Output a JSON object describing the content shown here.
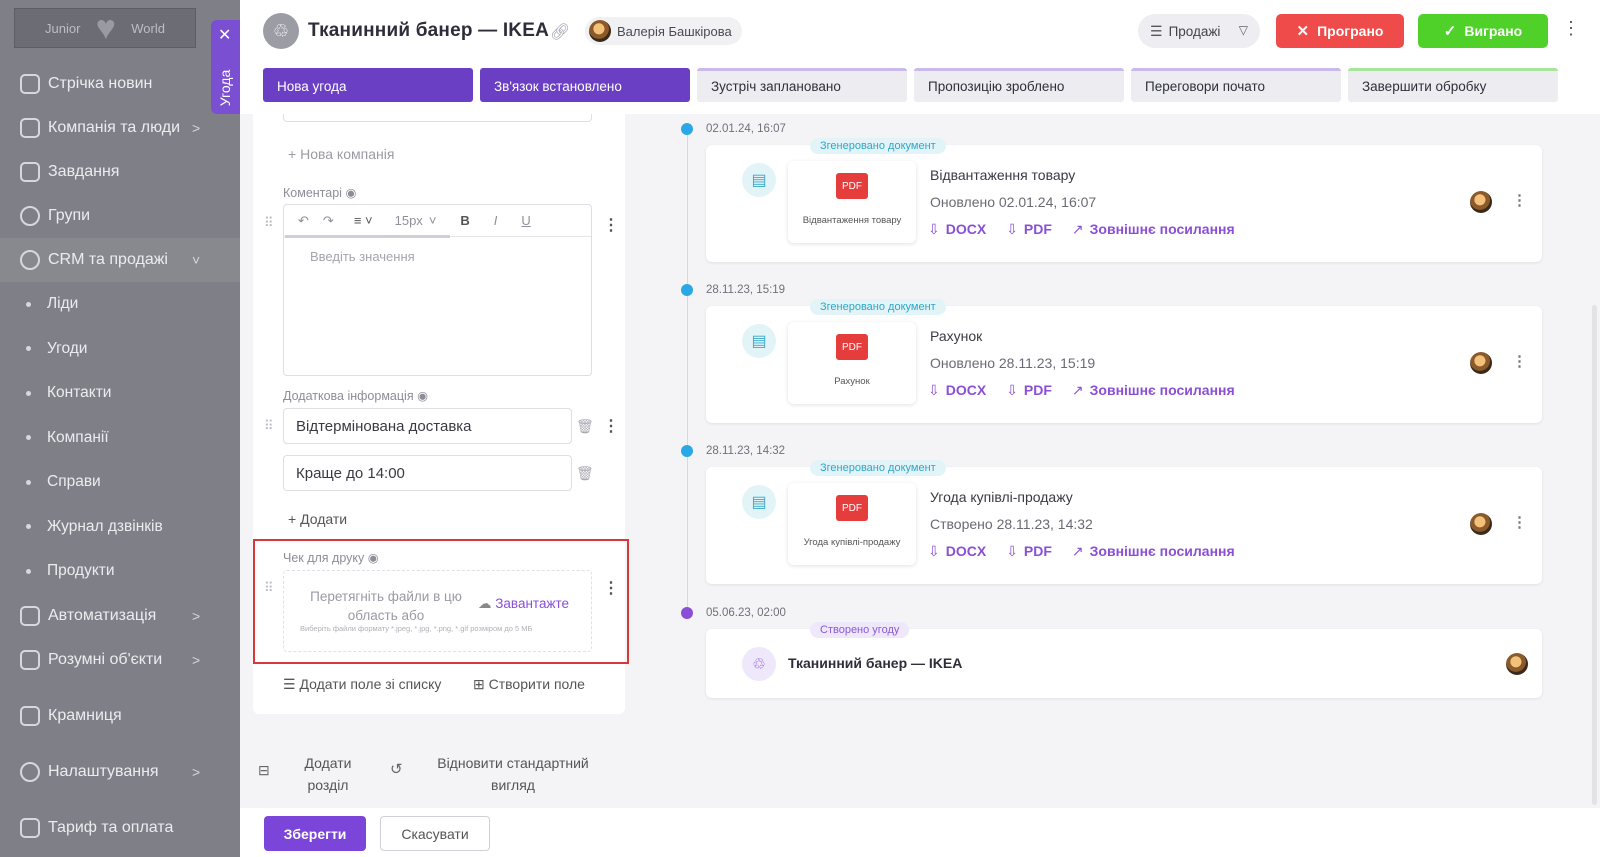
{
  "sidebar": {
    "logo": {
      "left": "Junior",
      "right": "World"
    },
    "items": [
      {
        "label": "Стрічка новин",
        "icon": "home-icon",
        "chevron": false
      },
      {
        "label": "Компанія та люди",
        "icon": "building-icon",
        "chevron": true
      },
      {
        "label": "Завдання",
        "icon": "calendar-icon",
        "chevron": false
      },
      {
        "label": "Групи",
        "icon": "users-icon",
        "chevron": false
      },
      {
        "label": "CRM та продажі",
        "icon": "crm-icon",
        "chevron": true
      }
    ],
    "sub_items": [
      "Ліди",
      "Угоди",
      "Контакти",
      "Компанії",
      "Справи",
      "Журнал дзвінків",
      "Продукти"
    ],
    "items_bottom": [
      {
        "label": "Автоматизація",
        "icon": "bolt-icon",
        "chevron": true
      },
      {
        "label": "Розумні об'єкти",
        "icon": "smart-objects-icon",
        "chevron": true
      },
      {
        "label": "Крамниця",
        "icon": "store-icon",
        "chevron": false
      },
      {
        "label": "Налаштування",
        "icon": "gear-icon",
        "chevron": true
      },
      {
        "label": "Тариф та оплата",
        "icon": "card-icon",
        "chevron": false
      }
    ]
  },
  "deal_tab": {
    "label": "Угода",
    "close": "✕"
  },
  "header": {
    "title": "Тканинний банер — IKEA",
    "user": "Валерія Башкірова",
    "pipeline": "Продажі",
    "lost_label": "Програно",
    "won_label": "Виграно"
  },
  "stages": [
    {
      "label": "Нова угода",
      "state": "done"
    },
    {
      "label": "Зв'язок встановлено",
      "state": "done"
    },
    {
      "label": "Зустріч заплановано",
      "state": "todo"
    },
    {
      "label": "Пропозицію зроблено",
      "state": "todo"
    },
    {
      "label": "Переговори почато",
      "state": "todo"
    },
    {
      "label": "Завершити обробку",
      "state": "todo"
    }
  ],
  "form": {
    "new_company": "Нова компанія",
    "comments_label": "Коментарі",
    "editor_font_size": "15px",
    "editor_placeholder": "Введіть значення",
    "extra_info_label": "Додаткова інформація",
    "extra_values": [
      "Відтермінована доставка",
      "Краще до 14:00"
    ],
    "add_label": "Додати",
    "receipt_label": "Чек для друку",
    "drop_text_1": "Перетягніть файли в цю",
    "drop_text_2": "область або",
    "upload_label": "Завантажте",
    "file_hint": "Виберіть файли формату *.jpeg, *.jpg, *.png, *.gif розміром до 5 МБ",
    "add_field_from_list": "Додати поле зі списку",
    "create_field": "Створити поле"
  },
  "section_actions": {
    "add_section_1": "Додати",
    "add_section_2": "розділ",
    "restore_1": "Відновити стандартний",
    "restore_2": "вигляд"
  },
  "footer": {
    "save": "Зберегти",
    "cancel": "Скасувати"
  },
  "timeline": [
    {
      "date": "02.01.24, 16:07",
      "badge": "Згенеровано документ",
      "thumb_caption": "Відвантаження товару",
      "name": "Відвантаження товару",
      "updated": "Оновлено 02.01.24, 16:07",
      "links": [
        "DOCX",
        "PDF",
        "Зовнішнє посилання"
      ]
    },
    {
      "date": "28.11.23, 15:19",
      "badge": "Згенеровано документ",
      "thumb_caption": "Рахунок",
      "name": "Рахунок",
      "updated": "Оновлено 28.11.23, 15:19",
      "links": [
        "DOCX",
        "PDF",
        "Зовнішнє посилання"
      ]
    },
    {
      "date": "28.11.23, 14:32",
      "badge": "Згенеровано документ",
      "thumb_caption": "Угода купівлі-продажу",
      "name": "Угода купівлі-продажу",
      "updated": "Створено 28.11.23, 14:32",
      "links": [
        "DOCX",
        "PDF",
        "Зовнішнє посилання"
      ]
    }
  ],
  "created": {
    "date": "05.06.23, 02:00",
    "badge": "Створено угоду",
    "title": "Тканинний банер — IKEA"
  },
  "pdf_label": "PDF",
  "colors": {
    "accent": "#7b45d9",
    "lost": "#f04b4b",
    "won": "#4fd12a",
    "timeline_dot": "#2aa8e6",
    "highlight": "#d93838"
  }
}
